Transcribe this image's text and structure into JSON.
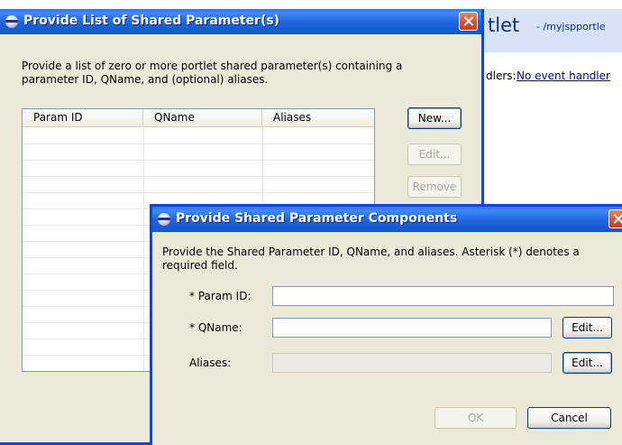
{
  "background_editor": {
    "title": "tlet",
    "subtitle": "- /myjspportle",
    "handlers_label": "dlers:",
    "handlers_link": "No event handler"
  },
  "list_dialog": {
    "title": "Provide List of Shared Parameter(s)",
    "description": "Provide a list of zero or more portlet shared parameter(s) containing a parameter ID, QName, and (optional) aliases.",
    "columns": [
      "Param ID",
      "QName",
      "Aliases"
    ],
    "buttons": {
      "new": "New...",
      "edit": "Edit...",
      "remove": "Remove"
    }
  },
  "component_dialog": {
    "title": "Provide Shared Parameter Components",
    "description": "Provide the Shared Parameter ID, QName, and aliases.  Asterisk (*) denotes a required field.",
    "fields": {
      "param_id": {
        "label": "* Param ID:",
        "value": ""
      },
      "qname": {
        "label": "* QName:",
        "value": "",
        "edit_label": "Edit..."
      },
      "aliases": {
        "label": "Aliases:",
        "value": "",
        "edit_label": "Edit..."
      }
    },
    "buttons": {
      "ok": "OK",
      "cancel": "Cancel"
    }
  },
  "colors": {
    "title_bar": "#1f63dd",
    "dialog_bg": "#ece9d8",
    "close_button": "#d85a34",
    "link": "#0000cc"
  }
}
